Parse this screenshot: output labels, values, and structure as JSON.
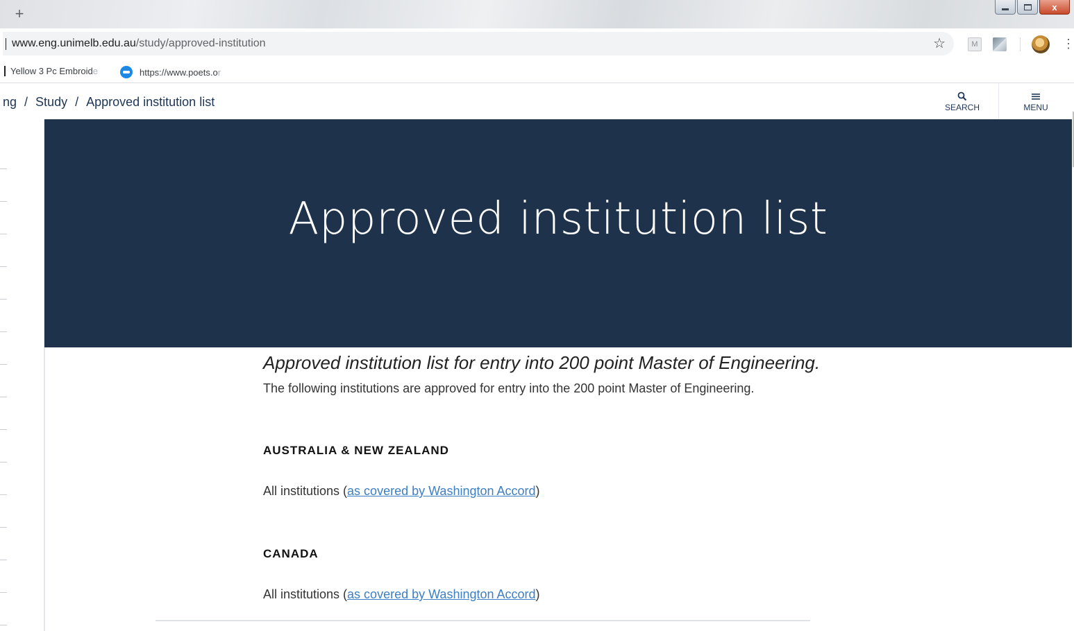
{
  "browser": {
    "new_tab": "+",
    "url_host": "www.eng.unimelb.edu.au",
    "url_path": "/study/approved-institution",
    "star": "☆",
    "ext_m": "M",
    "menu": "⋮",
    "window_close": "x",
    "bookmarks": [
      {
        "label": "Yellow 3 Pc Embroid",
        "fade": "e"
      },
      {
        "label": "https://www.poets.o",
        "fade": "r"
      }
    ]
  },
  "navbar": {
    "crumb_partial": "ng",
    "crumb_study": "Study",
    "crumb_current": "Approved institution list",
    "separator": "/",
    "search_label": "SEARCH",
    "menu_label": "MENU"
  },
  "hero": {
    "title": "Approved institution list"
  },
  "content": {
    "lead": "Approved institution list for entry into 200 point Master of Engineering.",
    "intro": "The following institutions are approved for entry into the 200 point Master of Engineering.",
    "sections": [
      {
        "heading": "AUSTRALIA & NEW ZEALAND",
        "text_before": "All institutions (",
        "link": "as covered by Washington Accord",
        "text_after": ")"
      },
      {
        "heading": "CANADA",
        "text_before": "All institutions (",
        "link": "as covered by Washington Accord",
        "text_after": ")"
      }
    ]
  }
}
